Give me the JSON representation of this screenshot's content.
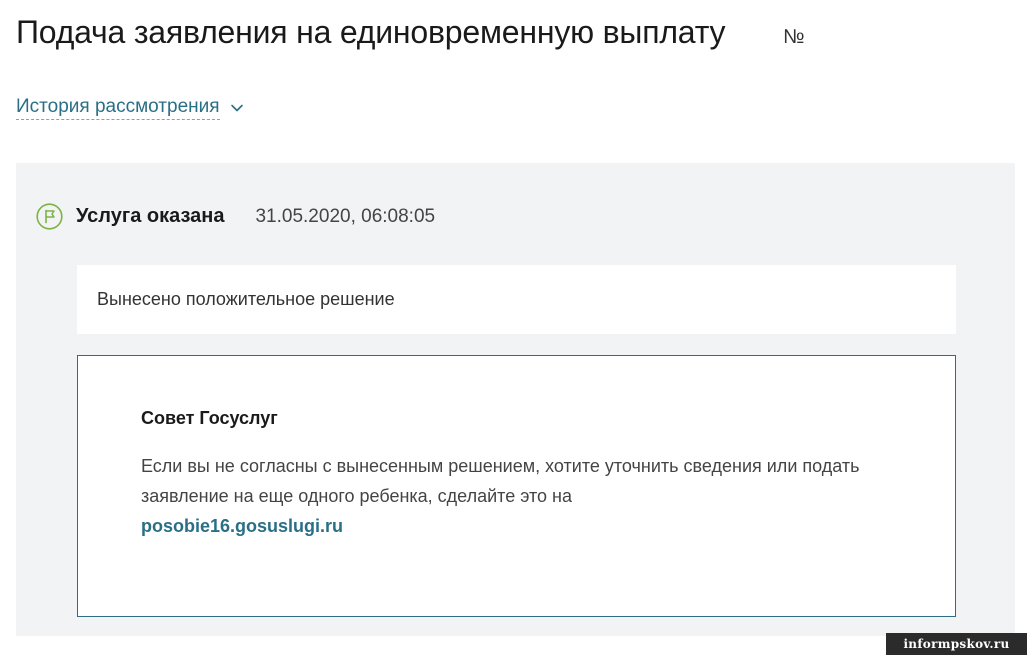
{
  "header": {
    "title": "Подача заявления на единовременную выплату",
    "number_label": "№"
  },
  "history": {
    "label": "История рассмотрения",
    "icon": "chevron-down-icon"
  },
  "status": {
    "icon": "flag-icon",
    "title": "Услуга оказана",
    "datetime": "31.05.2020, 06:08:05",
    "icon_color": "#7cb342"
  },
  "decision": {
    "text": "Вынесено положительное решение"
  },
  "advice": {
    "title": "Совет Госуслуг",
    "text": "Если вы не согласны с вынесенным решением, хотите уточнить сведения или подать заявление на еще одного ребенка, сделайте это на",
    "link_text": "posobie16.gosuslugi.ru",
    "border_color": "#2d6d86",
    "link_color": "#2a6f86"
  },
  "watermark": {
    "text": "informpskov.ru"
  }
}
